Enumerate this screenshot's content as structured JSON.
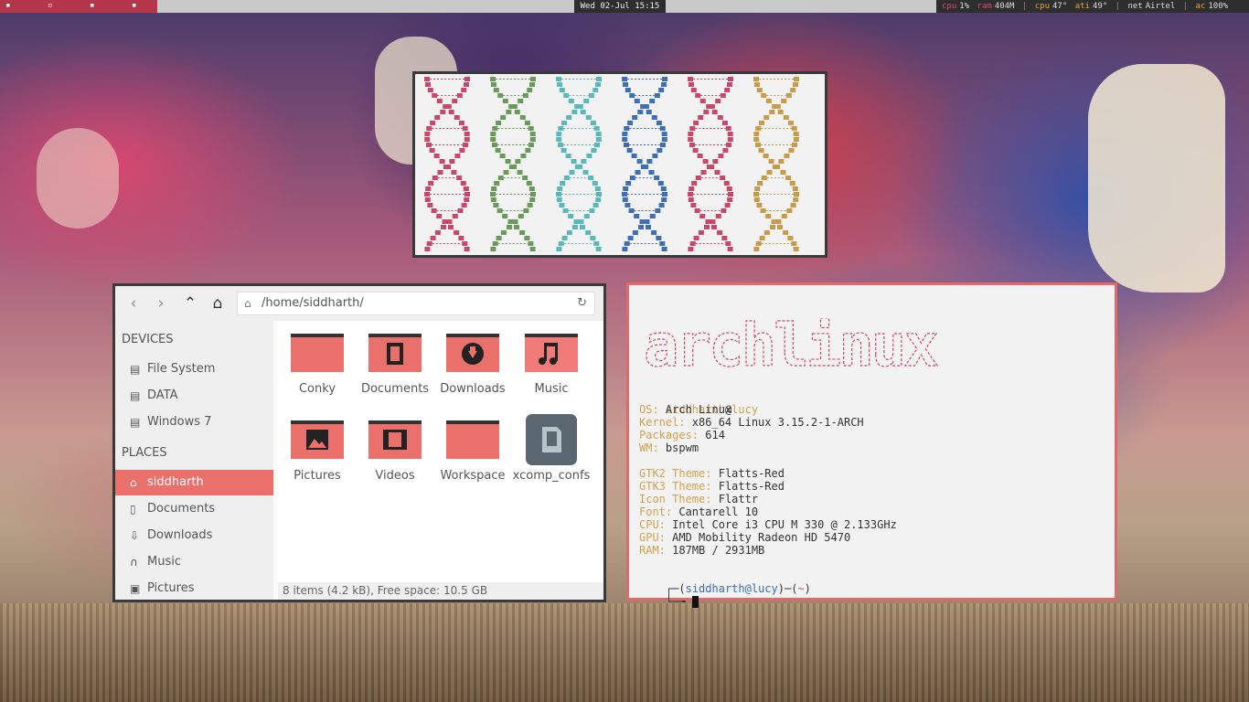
{
  "topbar": {
    "clock": "Wed 02-Jul 15:15",
    "cpu_label": "cpu",
    "cpu_value": "1%",
    "ram_label": "ram",
    "ram_value": "404M",
    "cpu_temp_label": "cpu",
    "cpu_temp_value": "47°",
    "ati_label": "ati",
    "ati_value": "49°",
    "net_label": "net",
    "net_value": "Airtel",
    "ac_label": "ac",
    "ac_value": "100%",
    "separator": "|"
  },
  "dna": {
    "colors": [
      "#c9486a",
      "#6a9a5a",
      "#5ab8bc",
      "#3e6eb4",
      "#c9486a",
      "#c99a4a"
    ]
  },
  "file_manager": {
    "location": "/home/siddharth/",
    "home_icon": "⌂",
    "reload_icon": "↻",
    "devices_header": "DEVICES",
    "places_header": "PLACES",
    "devices": [
      {
        "label": "File System",
        "icon": "hdd-icon"
      },
      {
        "label": "DATA",
        "icon": "hdd-icon"
      },
      {
        "label": "Windows 7",
        "icon": "hdd-icon"
      }
    ],
    "places": [
      {
        "label": "siddharth",
        "icon": "home-icon",
        "selected": true
      },
      {
        "label": "Documents",
        "icon": "document-icon"
      },
      {
        "label": "Downloads",
        "icon": "download-icon"
      },
      {
        "label": "Music",
        "icon": "headphones-icon"
      },
      {
        "label": "Pictures",
        "icon": "picture-icon"
      }
    ],
    "items": [
      {
        "name": "Conky",
        "type": "folder"
      },
      {
        "name": "Documents",
        "type": "folder-documents"
      },
      {
        "name": "Downloads",
        "type": "folder-downloads"
      },
      {
        "name": "Music",
        "type": "folder-music"
      },
      {
        "name": "Pictures",
        "type": "folder-pictures"
      },
      {
        "name": "Videos",
        "type": "folder-videos"
      },
      {
        "name": "Workspace",
        "type": "folder"
      },
      {
        "name": "xcomp_confs",
        "type": "file"
      }
    ],
    "status": "8 items (4.2 kB), Free space: 10.5 GB",
    "folder_color": "#e9706b"
  },
  "terminal": {
    "logo": "archlinux",
    "user": "siddharth",
    "at": "@",
    "host": "lucy",
    "info": [
      {
        "key": "OS:",
        "value": "Arch Linux"
      },
      {
        "key": "Kernel:",
        "value": "x86_64 Linux 3.15.2-1-ARCH"
      },
      {
        "key": "Packages:",
        "value": "614"
      },
      {
        "key": "WM:",
        "value": "bspwm"
      }
    ],
    "info2": [
      {
        "key": "GTK2 Theme:",
        "value": "Flatts-Red"
      },
      {
        "key": "GTK3 Theme:",
        "value": "Flatts-Red"
      },
      {
        "key": "Icon Theme:",
        "value": "Flattr"
      },
      {
        "key": "Font:",
        "value": "Cantarell 10"
      },
      {
        "key": "CPU:",
        "value": "Intel Core i3 CPU M 330 @ 2.133GHz"
      },
      {
        "key": "GPU:",
        "value": "AMD Mobility Radeon HD 5470"
      },
      {
        "key": "RAM:",
        "value": "187MB / 2931MB"
      }
    ],
    "prompt_user": "siddharth@lucy",
    "prompt_dir": "~",
    "prompt_line1_prefix": "┌─(",
    "prompt_line1_mid": ")─(",
    "prompt_line1_suffix": ")",
    "prompt_line2": "└─╼ "
  }
}
